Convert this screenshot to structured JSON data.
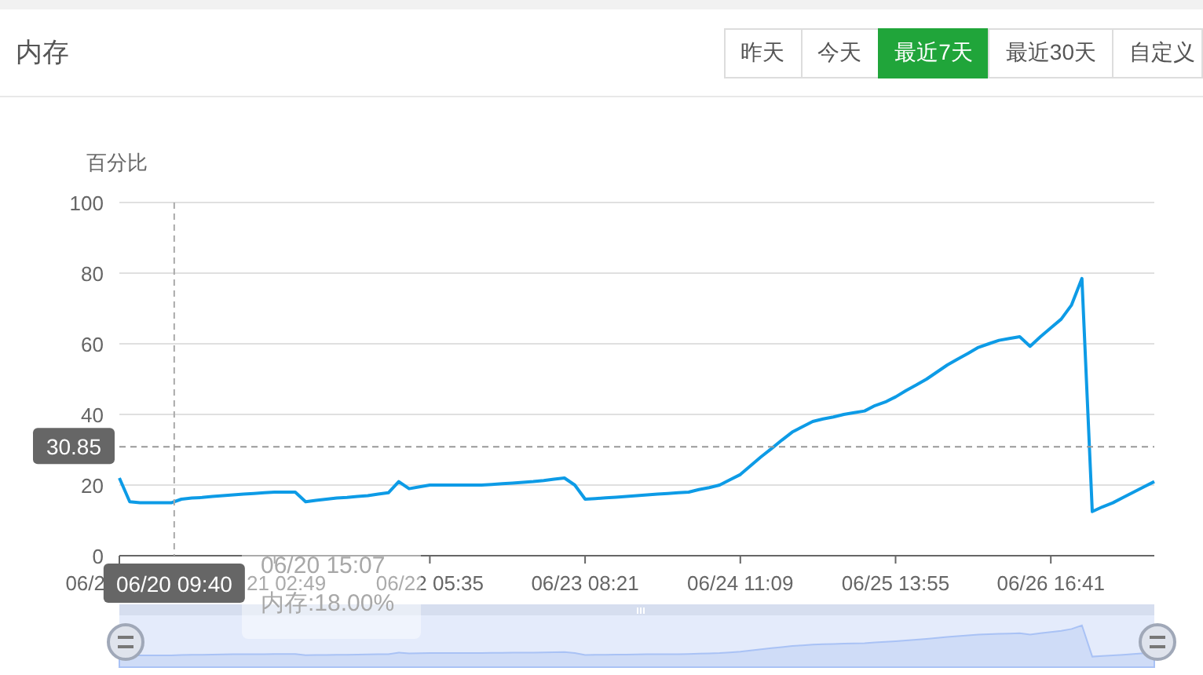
{
  "header": {
    "title": "内存"
  },
  "tabs": [
    {
      "label": "昨天",
      "selected": false
    },
    {
      "label": "今天",
      "selected": false
    },
    {
      "label": "最近7天",
      "selected": true
    },
    {
      "label": "最近30天",
      "selected": false
    },
    {
      "label": "自定义",
      "selected": false
    }
  ],
  "chart": {
    "chart_data": {
      "type": "line",
      "ylabel": "百分比",
      "ylim": [
        0,
        100
      ],
      "yticks": [
        0,
        20,
        40,
        60,
        80,
        100
      ],
      "grid": true,
      "ref_lines": [
        {
          "axis": "y",
          "value": 30.85,
          "label": "30.85"
        }
      ],
      "categories": [
        null,
        null,
        null,
        null,
        null,
        null,
        null,
        null,
        null,
        null,
        null,
        null,
        null,
        null,
        null,
        "21 02:49",
        null,
        null,
        null,
        null,
        null,
        null,
        null,
        null,
        null,
        null,
        null,
        null,
        null,
        null,
        "06/22 05:35",
        null,
        null,
        null,
        null,
        null,
        null,
        null,
        null,
        null,
        null,
        null,
        null,
        null,
        null,
        "06/23 08:21",
        null,
        null,
        null,
        null,
        null,
        null,
        null,
        null,
        null,
        null,
        null,
        null,
        null,
        null,
        "06/24 11:09",
        null,
        null,
        null,
        null,
        null,
        null,
        null,
        null,
        null,
        null,
        null,
        null,
        null,
        null,
        "06/25 13:55",
        null,
        null,
        null,
        null,
        null,
        null,
        null,
        null,
        null,
        null,
        null,
        null,
        null,
        null,
        "06/26 16:41",
        null,
        null,
        null,
        null,
        null,
        null,
        null,
        null,
        null,
        null
      ],
      "series": [
        {
          "name": "内存",
          "color": "#0d9be6",
          "values": [
            22,
            15.3,
            15,
            15,
            15,
            15,
            16,
            16.3,
            16.5,
            16.8,
            17,
            17.2,
            17.4,
            17.6,
            17.8,
            18,
            18,
            18,
            15.3,
            15.7,
            16,
            16.3,
            16.5,
            16.8,
            17,
            17.4,
            17.8,
            21,
            19,
            19.5,
            20,
            20,
            20,
            20,
            20,
            20,
            20.2,
            20.4,
            20.6,
            20.8,
            21,
            21.3,
            21.7,
            22,
            20,
            16,
            16.2,
            16.4,
            16.6,
            16.8,
            17,
            17.2,
            17.4,
            17.6,
            17.8,
            18,
            18.7,
            19.3,
            20,
            21.5,
            23,
            25.5,
            28,
            30.3,
            32.7,
            35,
            36.5,
            38,
            38.7,
            39.3,
            40,
            40.5,
            41,
            42.5,
            43.5,
            45,
            46.7,
            48.3,
            50,
            52,
            54,
            55.7,
            57.3,
            59,
            60,
            61,
            61.5,
            62,
            59.3,
            62,
            64.5,
            67,
            71,
            78.5,
            12.5,
            13.8,
            15,
            16.5,
            18,
            19.5,
            21
          ]
        }
      ]
    },
    "first_time_label": "06/2",
    "axis_pointer": {
      "x_label": "06/20 09:40"
    },
    "tooltip": {
      "time": "06/20 15:07",
      "value": ":18.00%"
    }
  }
}
